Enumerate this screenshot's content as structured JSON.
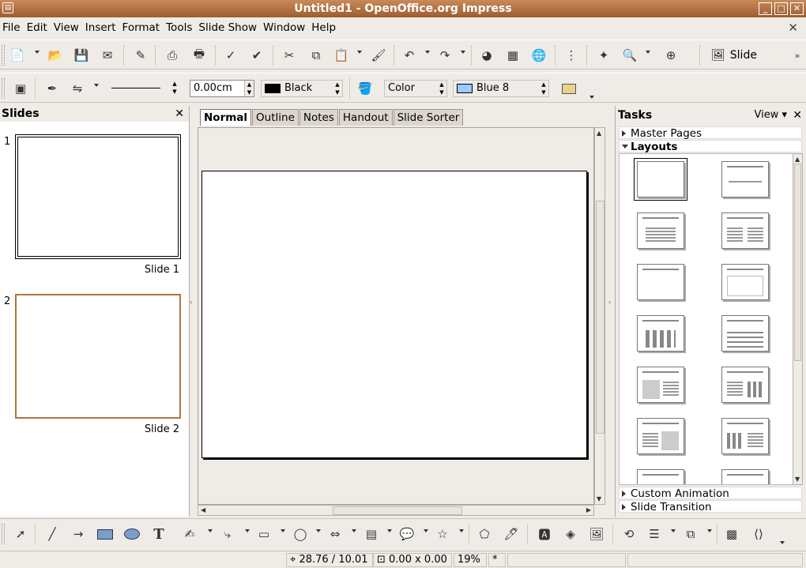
{
  "window": {
    "title": "Untitled1 - OpenOffice.org Impress"
  },
  "menu": [
    "File",
    "Edit",
    "View",
    "Insert",
    "Format",
    "Tools",
    "Slide Show",
    "Window",
    "Help"
  ],
  "line_toolbar": {
    "line_width": "0.00cm",
    "line_color": "Black",
    "area_style": "Color",
    "area_color": "Blue 8",
    "line_color_hex": "#000000",
    "area_color_hex": "#99ccff"
  },
  "toolbar": {
    "slide_button": "Slide"
  },
  "slides_panel": {
    "title": "Slides",
    "slides": [
      {
        "number": "1",
        "label": "Slide 1"
      },
      {
        "number": "2",
        "label": "Slide 2"
      }
    ]
  },
  "tabs": [
    "Normal",
    "Outline",
    "Notes",
    "Handout",
    "Slide Sorter"
  ],
  "tasks_panel": {
    "title": "Tasks",
    "view_label": "View",
    "sections": {
      "master_pages": "Master Pages",
      "layouts": "Layouts",
      "custom_animation": "Custom Animation",
      "slide_transition": "Slide Transition"
    }
  },
  "status": {
    "position": "28.76 / 10.01",
    "size": "0.00 x 0.00",
    "zoom": "19%",
    "modified": "*"
  }
}
